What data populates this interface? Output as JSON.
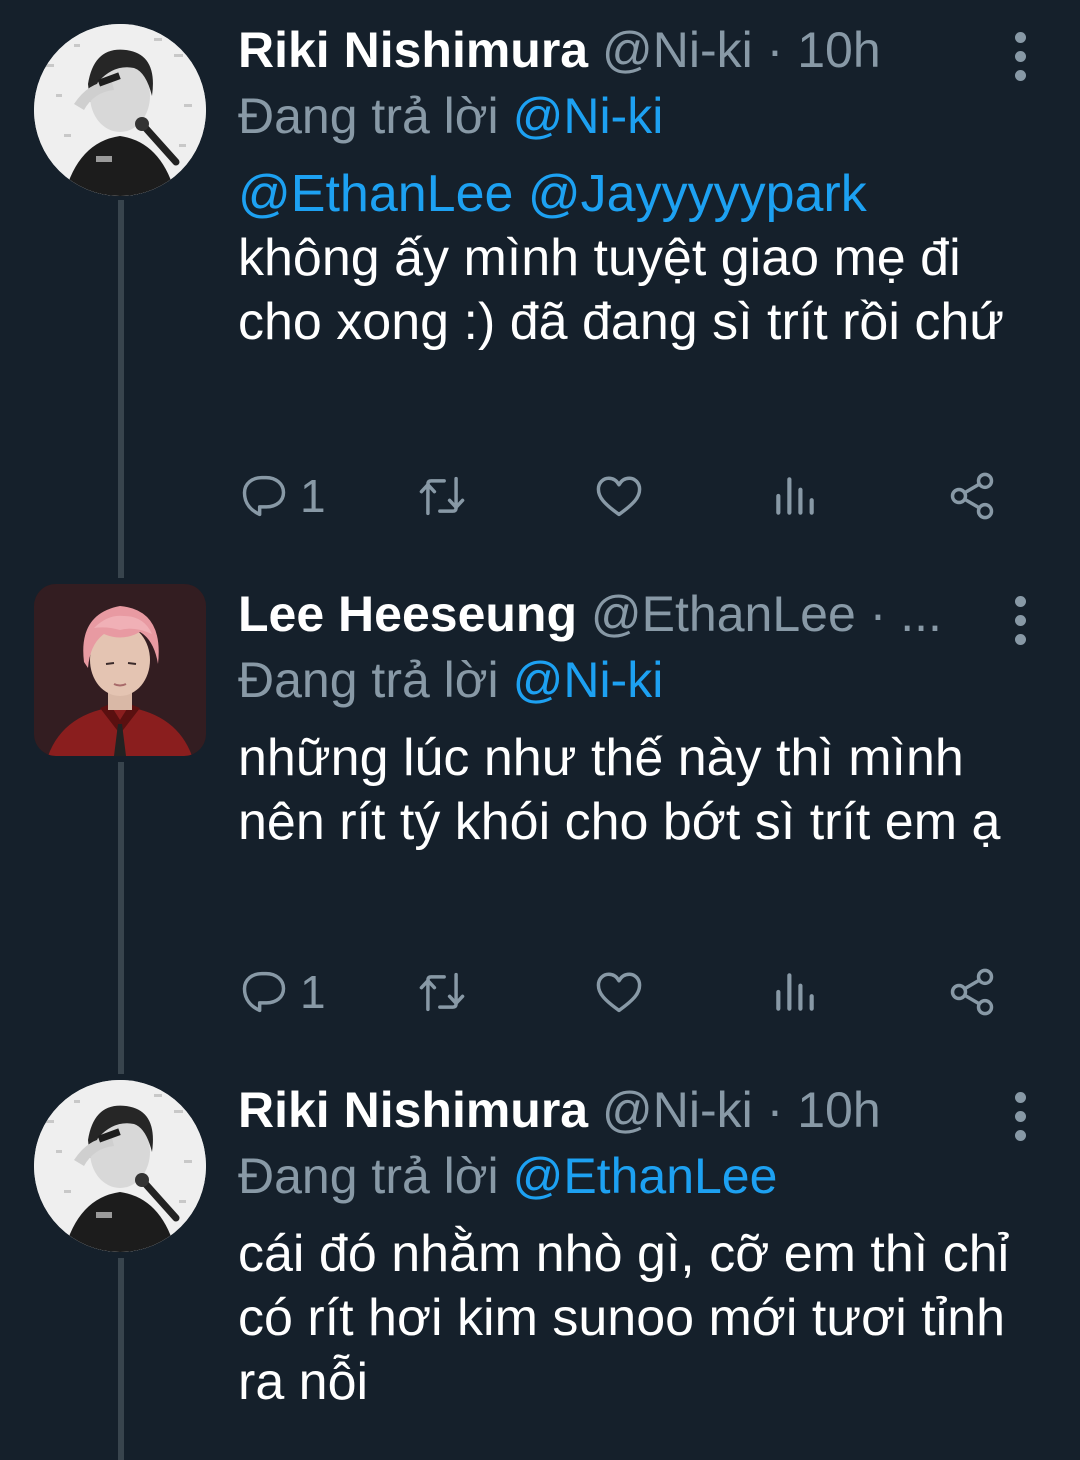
{
  "tweets": [
    {
      "name": "Riki Nishimura",
      "handle": "@Ni-ki",
      "time_sep": "·",
      "time": "10h",
      "reply_prefix": "Đang trả lời",
      "reply_to": "@Ni-ki",
      "mentions": "@EthanLee @Jayyyyypark",
      "text": "không ấy mình tuyệt giao mẹ đi cho xong :) đã đang sì trít rồi chứ",
      "reply_count": "1",
      "avatar_icon": "boy-with-microphone-avatar"
    },
    {
      "name": "Lee Heeseung",
      "handle": "@EthanLee",
      "time_sep": "·",
      "time": "...",
      "reply_prefix": "Đang trả lời",
      "reply_to": "@Ni-ki",
      "mentions": "",
      "text": "những lúc như thế này thì mình nên rít tý khói cho bớt sì trít em ạ",
      "reply_count": "1",
      "avatar_icon": "pink-hair-man-avatar"
    },
    {
      "name": "Riki Nishimura",
      "handle": "@Ni-ki",
      "time_sep": "·",
      "time": "10h",
      "reply_prefix": "Đang trả lời",
      "reply_to": "@EthanLee",
      "mentions": "",
      "text": "cái đó nhằm nhò gì, cỡ em thì chỉ có rít hơi kim sunoo mới tươi tỉnh ra nỗi",
      "reply_count": "",
      "avatar_icon": "boy-with-microphone-avatar"
    }
  ],
  "icons": {
    "reply": "reply-icon",
    "retweet": "retweet-icon",
    "like": "heart-icon",
    "analytics": "analytics-icon",
    "share": "share-icon",
    "more": "more-vertical-icon"
  },
  "colors": {
    "background": "#15202b",
    "primary_text": "#ffffff",
    "secondary_text": "#8899a6",
    "accent": "#1da1f2",
    "thread_line": "#38444d"
  }
}
